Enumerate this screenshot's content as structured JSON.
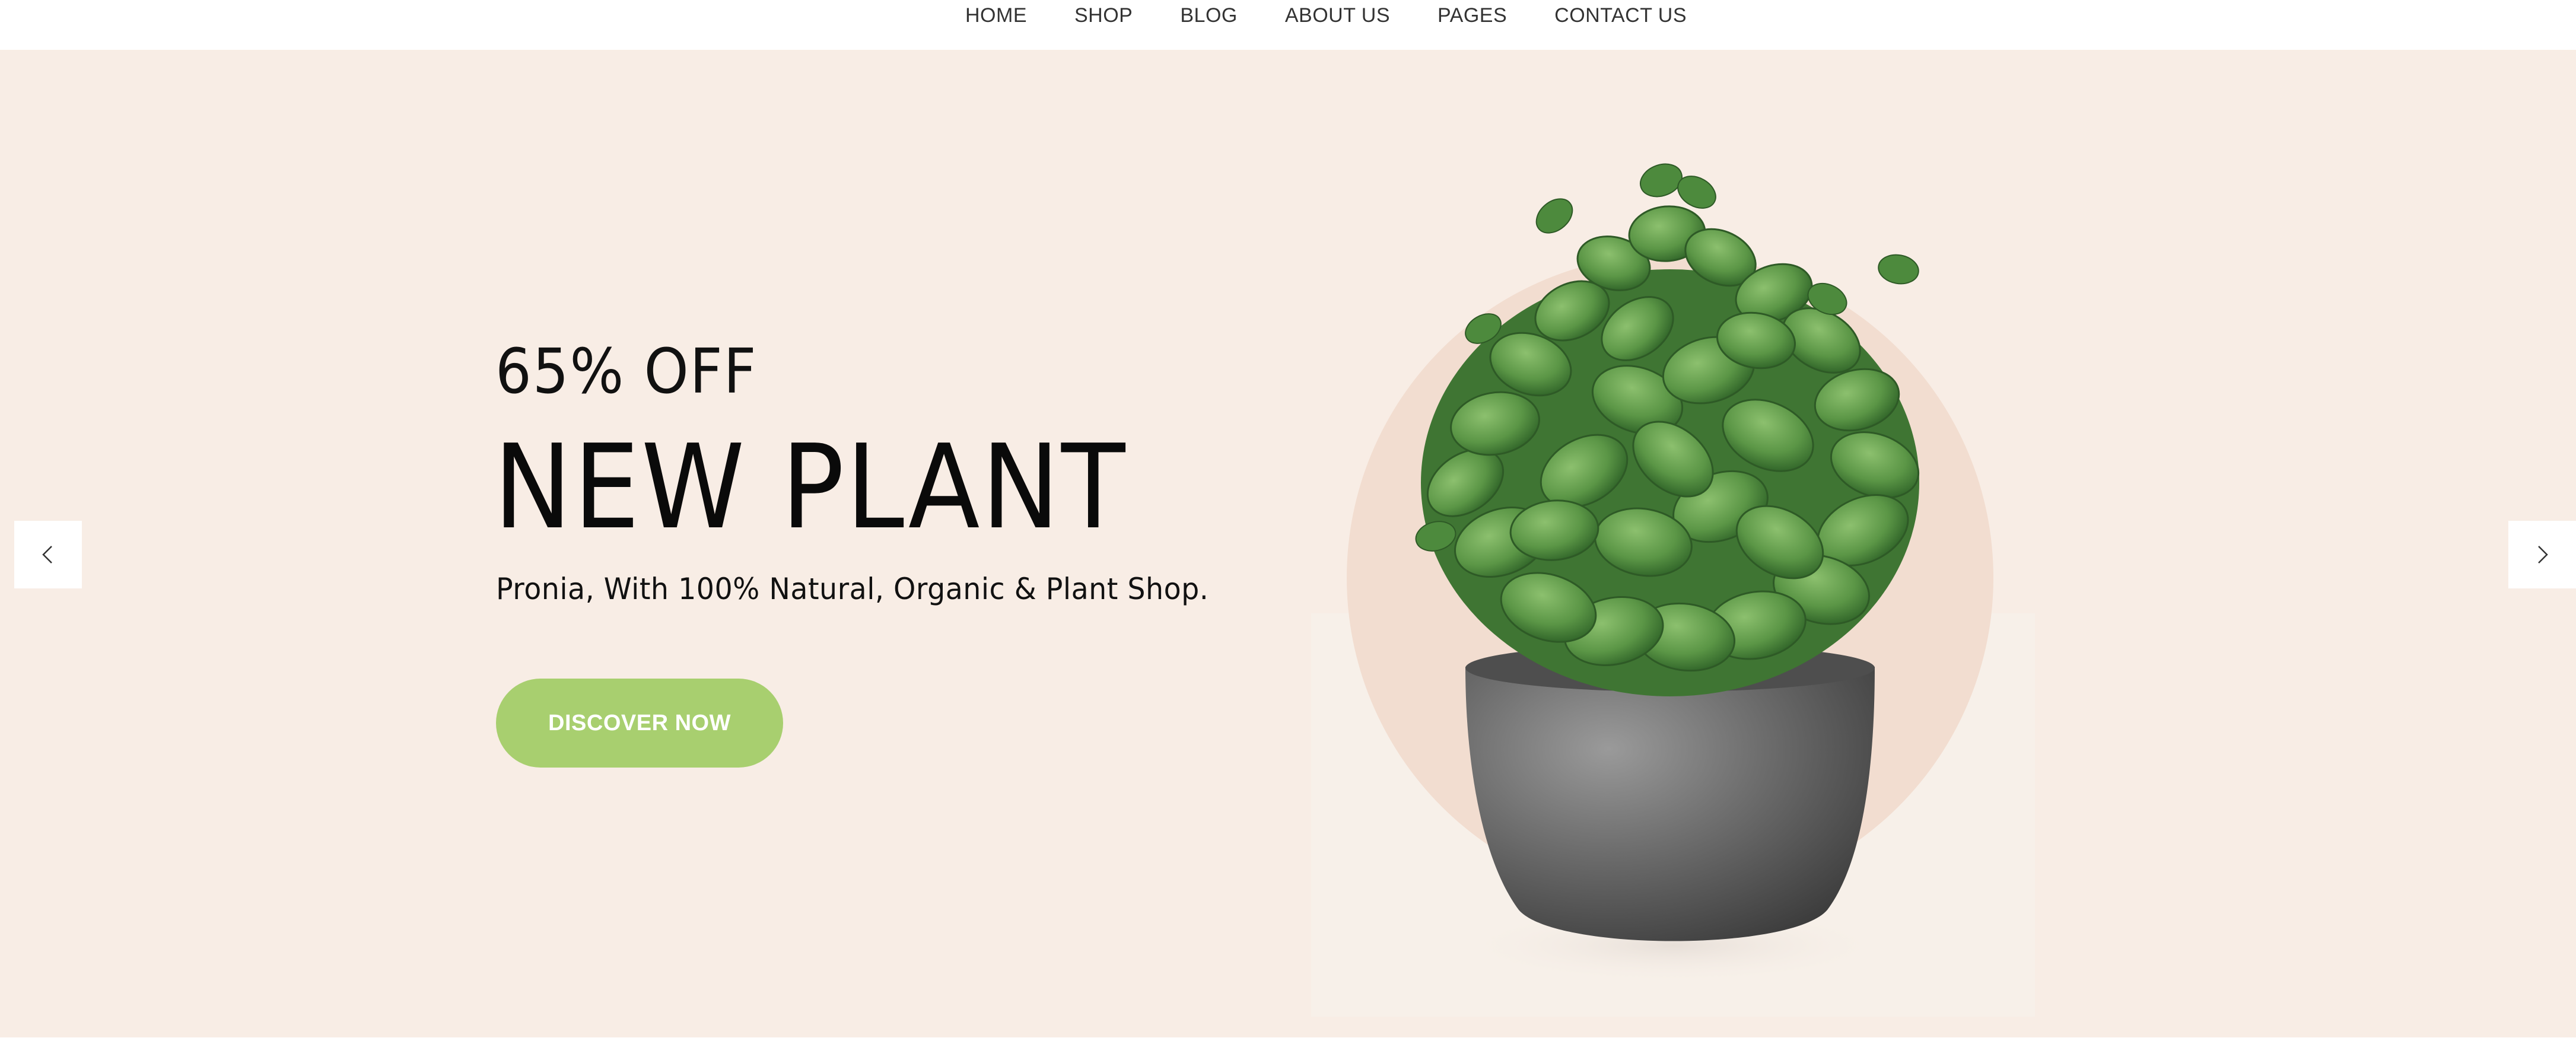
{
  "nav": {
    "items": [
      {
        "label": "HOME"
      },
      {
        "label": "SHOP"
      },
      {
        "label": "BLOG"
      },
      {
        "label": "ABOUT US"
      },
      {
        "label": "PAGES"
      },
      {
        "label": "CONTACT US"
      }
    ]
  },
  "hero": {
    "offer": "65% OFF",
    "headline": "NEW PLANT",
    "subtext": "Pronia, With 100% Natural, Organic & Plant Shop.",
    "cta_label": "DISCOVER NOW",
    "prev_icon": "chevron-left-icon",
    "next_icon": "chevron-right-icon",
    "image": "potted-plant-image"
  },
  "colors": {
    "hero_background": "#f8ede5",
    "accent_green": "#a8cf6f",
    "circle": "#f2ddd0",
    "pot": "#6b6b6b",
    "foliage": "#4f8a3f"
  }
}
